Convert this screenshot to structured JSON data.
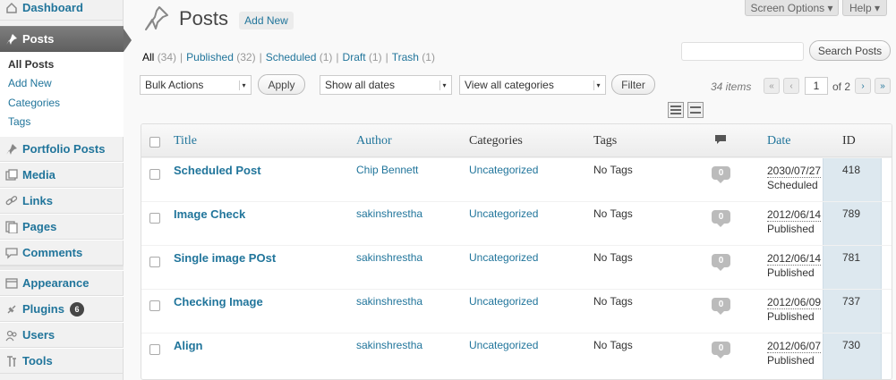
{
  "sidebar": {
    "items": [
      {
        "label": "Dashboard",
        "icon": "dashboard-icon"
      },
      {
        "label": "Posts",
        "icon": "pushpin-icon"
      },
      {
        "label": "Portfolio Posts",
        "icon": "pushpin-icon"
      },
      {
        "label": "Media",
        "icon": "media-icon"
      },
      {
        "label": "Links",
        "icon": "links-icon"
      },
      {
        "label": "Pages",
        "icon": "pages-icon"
      },
      {
        "label": "Comments",
        "icon": "comments-icon"
      },
      {
        "label": "Appearance",
        "icon": "appearance-icon"
      },
      {
        "label": "Plugins",
        "icon": "plugins-icon",
        "badge": "6"
      },
      {
        "label": "Users",
        "icon": "users-icon"
      },
      {
        "label": "Tools",
        "icon": "tools-icon"
      }
    ],
    "submenu": [
      "All Posts",
      "Add New",
      "Categories",
      "Tags"
    ]
  },
  "header": {
    "title": "Posts",
    "add_new": "Add New",
    "screen_options": "Screen Options ▾",
    "help": "Help ▾"
  },
  "filters": {
    "views": [
      {
        "label": "All",
        "count": "(34)"
      },
      {
        "label": "Published",
        "count": "(32)"
      },
      {
        "label": "Scheduled",
        "count": "(1)"
      },
      {
        "label": "Draft",
        "count": "(1)"
      },
      {
        "label": "Trash",
        "count": "(1)"
      }
    ],
    "search_button": "Search Posts",
    "bulk_actions": "Bulk Actions",
    "apply": "Apply",
    "dates": "Show all dates",
    "categories": "View all categories",
    "filter": "Filter"
  },
  "pagination": {
    "items": "34 items",
    "first": "«",
    "prev": "‹",
    "current": "1",
    "of": "of 2",
    "next": "›",
    "last": "»"
  },
  "table": {
    "headers": {
      "title": "Title",
      "author": "Author",
      "categories": "Categories",
      "tags": "Tags",
      "date": "Date",
      "id": "ID"
    },
    "rows": [
      {
        "title": "Scheduled Post",
        "author": "Chip Bennett",
        "categories": "Uncategorized",
        "tags": "No Tags",
        "comments": "0",
        "date": "2030/07/27",
        "status": "Scheduled",
        "id": "418"
      },
      {
        "title": "Image Check",
        "author": "sakinshrestha",
        "categories": "Uncategorized",
        "tags": "No Tags",
        "comments": "0",
        "date": "2012/06/14",
        "status": "Published",
        "id": "789"
      },
      {
        "title": "Single image POst",
        "author": "sakinshrestha",
        "categories": "Uncategorized",
        "tags": "No Tags",
        "comments": "0",
        "date": "2012/06/14",
        "status": "Published",
        "id": "781"
      },
      {
        "title": "Checking Image",
        "author": "sakinshrestha",
        "categories": "Uncategorized",
        "tags": "No Tags",
        "comments": "0",
        "date": "2012/06/09",
        "status": "Published",
        "id": "737"
      },
      {
        "title": "Align",
        "author": "sakinshrestha",
        "categories": "Uncategorized",
        "tags": "No Tags",
        "comments": "0",
        "date": "2012/06/07",
        "status": "Published",
        "id": "730"
      }
    ]
  }
}
